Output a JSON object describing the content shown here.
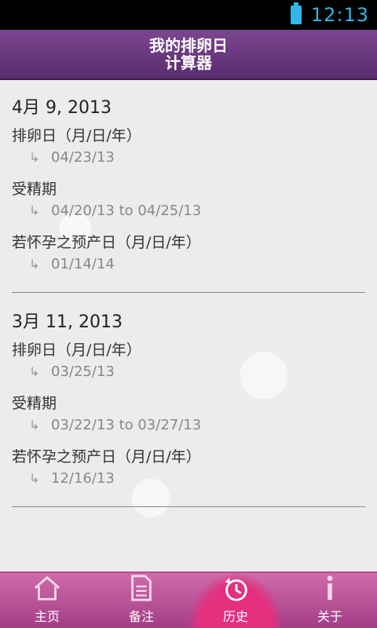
{
  "status_bar": {
    "time": "12:13"
  },
  "header": {
    "title_line1": "我的排卵日",
    "title_line2": "计算器"
  },
  "records": [
    {
      "date": "4月 9, 2013",
      "ovulation_label": "排卵日（月/日/年）",
      "ovulation_value": "04/23/13",
      "fertile_label": "受精期",
      "fertile_value": "04/20/13 to 04/25/13",
      "due_label": "若怀孕之预产日（月/日/年）",
      "due_value": "01/14/14"
    },
    {
      "date": "3月 11, 2013",
      "ovulation_label": "排卵日（月/日/年）",
      "ovulation_value": "03/25/13",
      "fertile_label": "受精期",
      "fertile_value": "03/22/13 to 03/27/13",
      "due_label": "若怀孕之预产日（月/日/年）",
      "due_value": "12/16/13"
    }
  ],
  "tabs": [
    {
      "label": "主页",
      "icon": "home-icon"
    },
    {
      "label": "备注",
      "icon": "notes-icon"
    },
    {
      "label": "历史",
      "icon": "history-icon"
    },
    {
      "label": "关于",
      "icon": "info-icon"
    }
  ],
  "colors": {
    "header": "#6a3880",
    "tab_bar": "#c15aa0",
    "active_tab": "#e4307f",
    "status_accent": "#33b5e5"
  }
}
